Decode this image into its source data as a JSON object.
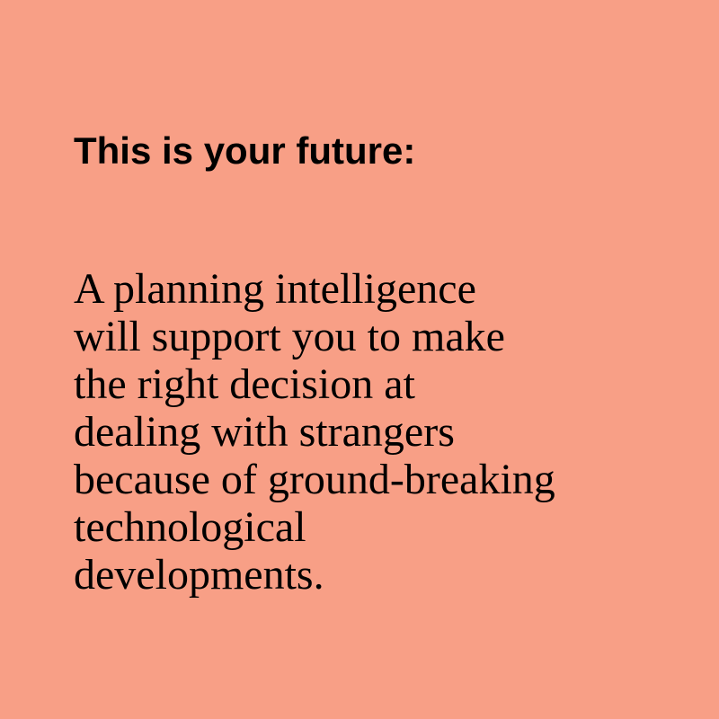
{
  "background_color": "#f89f86",
  "text_color": "#000000",
  "heading": "This is your future:",
  "body_lines": [
    "A planning intelligence",
    "will support you to make",
    "the right decision at",
    "dealing with strangers",
    "because of ground-breaking",
    "technological",
    "developments."
  ]
}
